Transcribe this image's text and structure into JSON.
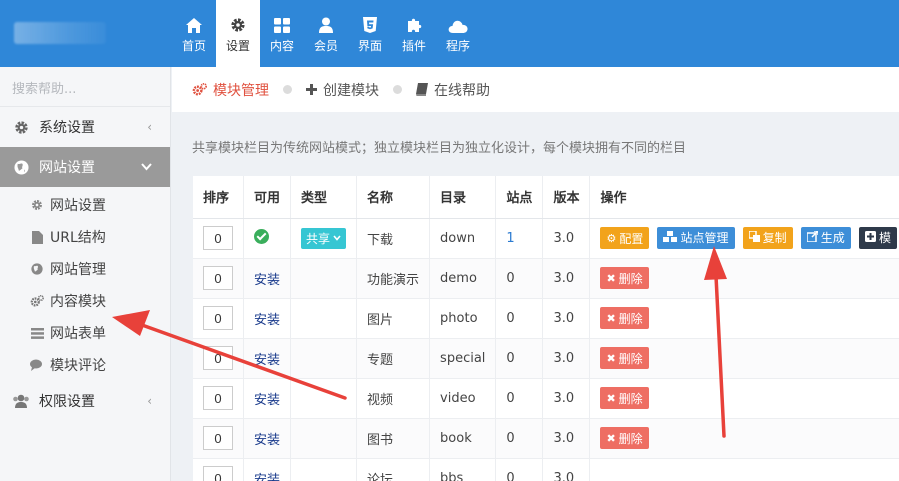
{
  "topnav": [
    {
      "label": "首页",
      "icon": "home-icon",
      "active": false
    },
    {
      "label": "设置",
      "icon": "gear-icon",
      "active": true
    },
    {
      "label": "内容",
      "icon": "grid-icon",
      "active": false
    },
    {
      "label": "会员",
      "icon": "user-icon",
      "active": false
    },
    {
      "label": "界面",
      "icon": "html5-icon",
      "active": false
    },
    {
      "label": "插件",
      "icon": "puzzle-icon",
      "active": false
    },
    {
      "label": "程序",
      "icon": "cloud-icon",
      "active": false
    }
  ],
  "sidebar": {
    "search_placeholder": "搜索帮助...",
    "groups": [
      {
        "label": "系统设置",
        "icon": "gear-icon"
      },
      {
        "label": "网站设置",
        "icon": "globe-icon"
      },
      {
        "label": "权限设置",
        "icon": "users-icon"
      }
    ],
    "subitems": [
      {
        "label": "网站设置",
        "icon": "gear-icon"
      },
      {
        "label": "URL结构",
        "icon": "file-icon"
      },
      {
        "label": "网站管理",
        "icon": "globe-icon"
      },
      {
        "label": "内容模块",
        "icon": "gears-icon"
      },
      {
        "label": "网站表单",
        "icon": "list-icon"
      },
      {
        "label": "模块评论",
        "icon": "comments-icon"
      }
    ]
  },
  "tabs": [
    {
      "label": "模块管理",
      "icon": "gears-icon",
      "active": true
    },
    {
      "label": "创建模块",
      "icon": "plus-icon",
      "active": false
    },
    {
      "label": "在线帮助",
      "icon": "book-icon",
      "active": false
    }
  ],
  "description": "共享模块栏目为传统网站模式；独立模块栏目为独立化设计，每个模块拥有不同的栏目",
  "table": {
    "headers": [
      "排序",
      "可用",
      "类型",
      "名称",
      "目录",
      "站点",
      "版本",
      "操作"
    ],
    "rows": [
      {
        "order": "0",
        "status": "enabled",
        "type": "共享",
        "name": "下载",
        "dir": "down",
        "sites": "1",
        "version": "3.0",
        "actions": [
          {
            "label": "配置",
            "icon": "gear-icon",
            "color": "orange"
          },
          {
            "label": "站点管理",
            "icon": "cubes-icon",
            "color": "blue"
          },
          {
            "label": "复制",
            "icon": "copy-icon",
            "color": "orange"
          },
          {
            "label": "生成",
            "icon": "external-icon",
            "color": "blue"
          },
          {
            "label": "模",
            "icon": "plus-square-icon",
            "color": "dark"
          }
        ]
      },
      {
        "order": "0",
        "status": "安装",
        "type": "",
        "name": "功能演示",
        "dir": "demo",
        "sites": "0",
        "version": "3.0",
        "actions": [
          {
            "label": "删除",
            "icon": "x-icon",
            "color": "red"
          }
        ]
      },
      {
        "order": "0",
        "status": "安装",
        "type": "",
        "name": "图片",
        "dir": "photo",
        "sites": "0",
        "version": "3.0",
        "actions": [
          {
            "label": "删除",
            "icon": "x-icon",
            "color": "red"
          }
        ]
      },
      {
        "order": "0",
        "status": "安装",
        "type": "",
        "name": "专题",
        "dir": "special",
        "sites": "0",
        "version": "3.0",
        "actions": [
          {
            "label": "删除",
            "icon": "x-icon",
            "color": "red"
          }
        ]
      },
      {
        "order": "0",
        "status": "安装",
        "type": "",
        "name": "视频",
        "dir": "video",
        "sites": "0",
        "version": "3.0",
        "actions": [
          {
            "label": "删除",
            "icon": "x-icon",
            "color": "red"
          }
        ]
      },
      {
        "order": "0",
        "status": "安装",
        "type": "",
        "name": "图书",
        "dir": "book",
        "sites": "0",
        "version": "3.0",
        "actions": [
          {
            "label": "删除",
            "icon": "x-icon",
            "color": "red"
          }
        ]
      },
      {
        "order": "0",
        "status": "安装",
        "type": "",
        "name": "论坛",
        "dir": "bbs",
        "sites": "0",
        "version": "3.0",
        "actions": []
      }
    ]
  },
  "colors": {
    "topbar": "#2f87d8",
    "active_tab": "#e0513f",
    "arrow": "#e8413a"
  }
}
